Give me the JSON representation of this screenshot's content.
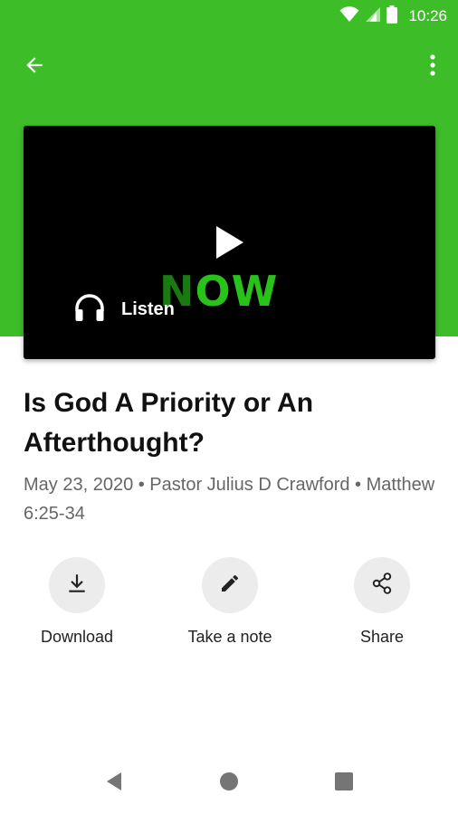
{
  "status_bar": {
    "time": "10:26",
    "icons": [
      "wifi-icon",
      "cellular-signal-icon",
      "battery-icon"
    ]
  },
  "app_bar": {
    "back_icon": "arrow-back-icon",
    "menu_icon": "more-vert-icon"
  },
  "media": {
    "logo_text_first": "N",
    "logo_text_rest": "OW",
    "play_icon": "play-icon",
    "listen_label": "Listen",
    "listen_icon": "headphones-icon"
  },
  "sermon": {
    "title": "Is God A Priority or An Afterthought?",
    "meta": "May 23, 2020 • Pastor Julius D Crawford • Matthew 6:25-34"
  },
  "actions": [
    {
      "label": "Download",
      "icon": "download-icon"
    },
    {
      "label": "Take a note",
      "icon": "pencil-icon"
    },
    {
      "label": "Share",
      "icon": "share-icon"
    }
  ],
  "nav_bar": {
    "icons": [
      "back-triangle-icon",
      "home-circle-icon",
      "recents-square-icon"
    ]
  },
  "colors": {
    "brand_green": "#3dbe29",
    "logo_dark_green": "#1a7a12",
    "logo_green": "#28c21a"
  }
}
